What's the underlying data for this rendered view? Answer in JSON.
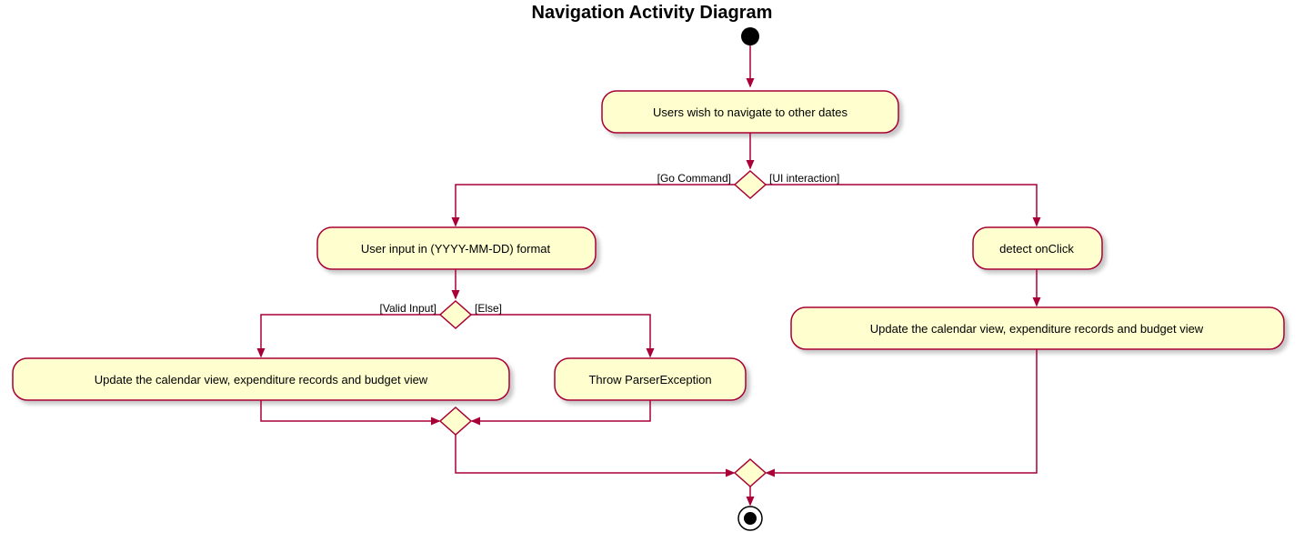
{
  "title": "Navigation Activity Diagram",
  "nodes": {
    "start_activity": "Users wish to navigate to other dates",
    "go_input": "User input in (YYYY-MM-DD) format",
    "update_left": "Update the calendar view, expenditure records and budget view",
    "throw_err": "Throw ParserException",
    "detect_click": "detect onClick",
    "update_right": "Update the calendar view, expenditure records and budget view"
  },
  "branches": {
    "top_left": "[Go Command]",
    "top_right": "[UI interaction]",
    "mid_left": "[Valid Input]",
    "mid_right": "[Else]"
  }
}
